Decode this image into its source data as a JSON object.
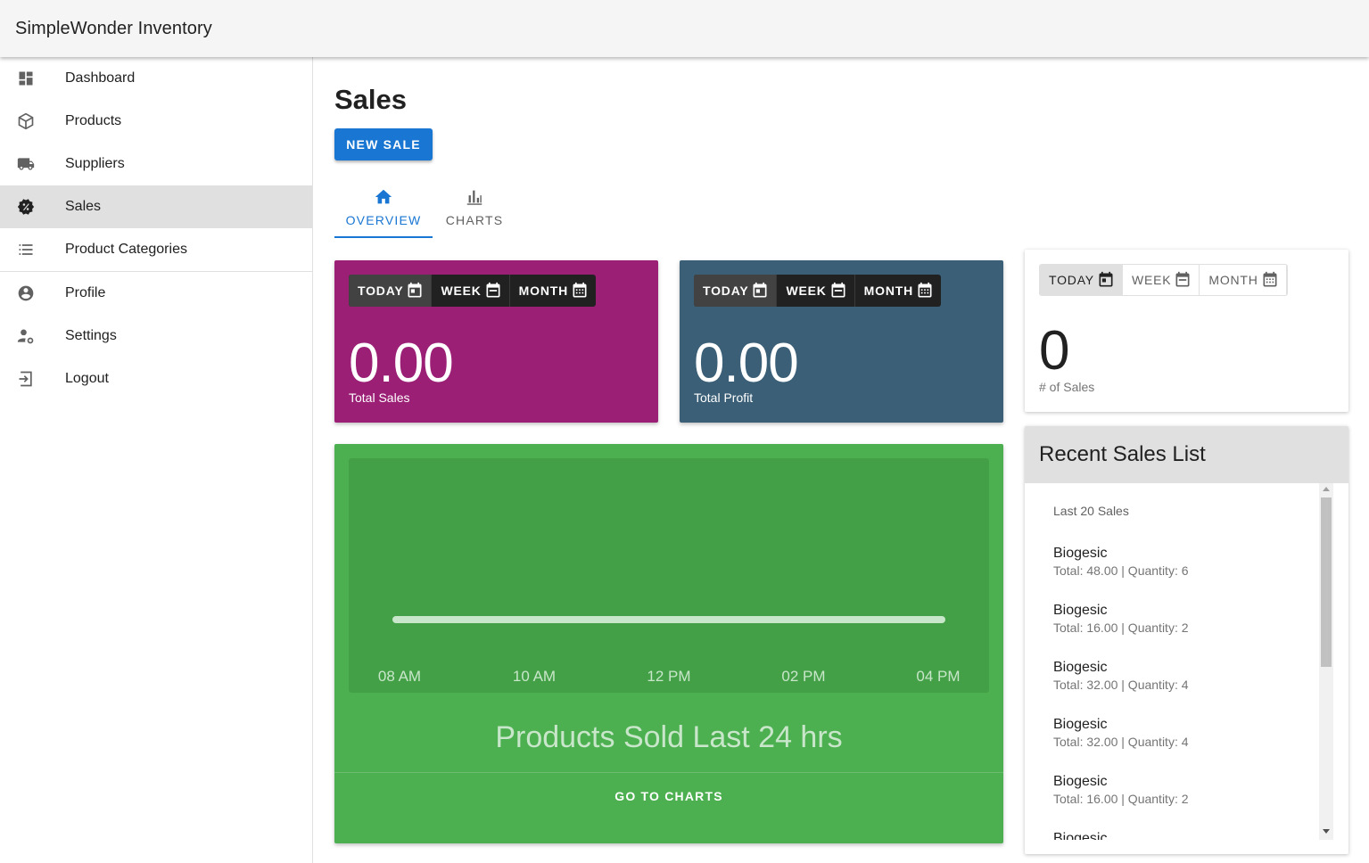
{
  "app": {
    "title": "SimpleWonder Inventory"
  },
  "sidebar": {
    "items": [
      {
        "label": "Dashboard",
        "icon": "dashboard-icon"
      },
      {
        "label": "Products",
        "icon": "products-icon"
      },
      {
        "label": "Suppliers",
        "icon": "truck-icon"
      },
      {
        "label": "Sales",
        "icon": "sales-badge-icon",
        "active": true
      },
      {
        "label": "Product Categories",
        "icon": "list-icon"
      },
      {
        "label": "Profile",
        "icon": "account-circle-icon"
      },
      {
        "label": "Settings",
        "icon": "user-settings-icon"
      },
      {
        "label": "Logout",
        "icon": "logout-icon"
      }
    ]
  },
  "page": {
    "title": "Sales",
    "new_sale_label": "NEW SALE"
  },
  "tabs": [
    {
      "label": "OVERVIEW",
      "icon": "home-icon",
      "active": true
    },
    {
      "label": "CHARTS",
      "icon": "bar-chart-icon",
      "active": false
    }
  ],
  "range_toggle": {
    "today": "TODAY",
    "week": "WEEK",
    "month": "MONTH"
  },
  "stats": {
    "total_sales": {
      "value": "0.00",
      "label": "Total Sales",
      "color": "#9b1f75"
    },
    "total_profit": {
      "value": "0.00",
      "label": "Total Profit",
      "color": "#3a5f77"
    },
    "num_sales": {
      "value": "0",
      "label": "# of Sales"
    }
  },
  "chart": {
    "caption": "Products Sold Last 24 hrs",
    "link_label": "GO TO CHARTS",
    "card_color": "#4caf50"
  },
  "chart_data": {
    "type": "line",
    "x": [
      "08 AM",
      "10 AM",
      "12 PM",
      "02 PM",
      "04 PM"
    ],
    "series": [
      {
        "values": [
          0,
          0,
          0,
          0,
          0
        ]
      }
    ]
  },
  "recent_sales": {
    "title": "Recent Sales List",
    "subheader": "Last 20 Sales",
    "items": [
      {
        "name": "Biogesic",
        "detail": "Total: 48.00 | Quantity: 6"
      },
      {
        "name": "Biogesic",
        "detail": "Total: 16.00 | Quantity: 2"
      },
      {
        "name": "Biogesic",
        "detail": "Total: 32.00 | Quantity: 4"
      },
      {
        "name": "Biogesic",
        "detail": "Total: 32.00 | Quantity: 4"
      },
      {
        "name": "Biogesic",
        "detail": "Total: 16.00 | Quantity: 2"
      },
      {
        "name": "Biogesic",
        "detail": ""
      }
    ]
  }
}
